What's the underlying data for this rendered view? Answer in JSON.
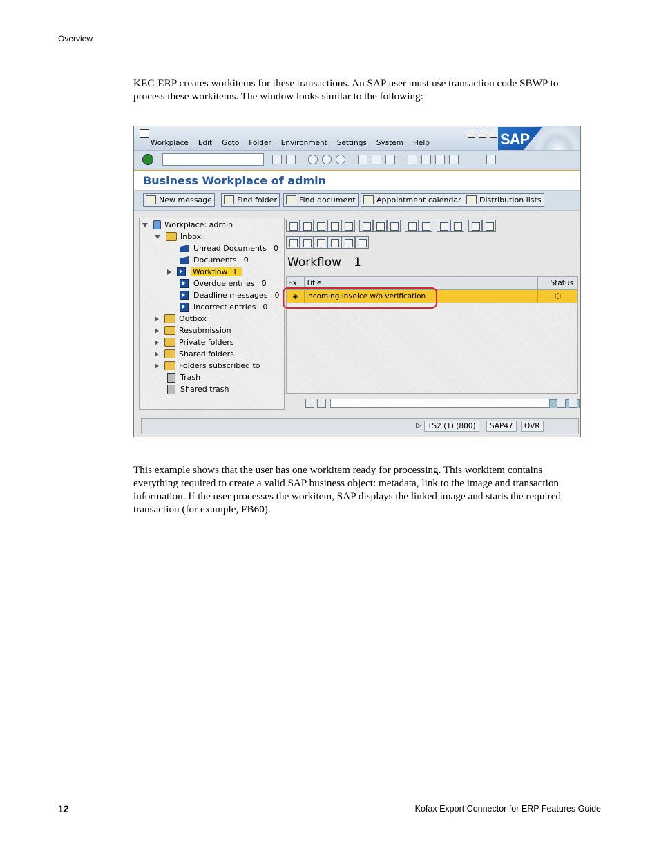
{
  "header": {
    "section": "Overview"
  },
  "intro_text": "KEC-ERP creates workitems for these transactions. An SAP user must use transaction code SBWP to process these workitems. The window looks similar to the following:",
  "closing_text": "This example shows that the user has one workitem ready for processing. This workitem contains everything required to create a valid SAP business object: metadata, link to the image and transaction information. If the user processes the workitem, SAP displays the linked image and starts the required transaction (for example, FB60).",
  "footer": {
    "page_number": "12",
    "doc_title": "Kofax Export Connector for ERP Features Guide"
  },
  "sap": {
    "logo": "SAP",
    "menu": [
      "Workplace",
      "Edit",
      "Goto",
      "Folder",
      "Environment",
      "Settings",
      "System",
      "Help"
    ],
    "screen_title": "Business Workplace of admin",
    "app_buttons": [
      "New message",
      "Find folder",
      "Find document",
      "Appointment calendar",
      "Distribution lists"
    ],
    "tree": {
      "root": "Workplace: admin",
      "inbox": "Inbox",
      "inbox_items": [
        {
          "label": "Unread Documents",
          "count": "0"
        },
        {
          "label": "Documents",
          "count": "0"
        },
        {
          "label": "Workflow",
          "count": "1"
        },
        {
          "label": "Overdue entries",
          "count": "0"
        },
        {
          "label": "Deadline messages",
          "count": "0"
        },
        {
          "label": "Incorrect entries",
          "count": "0"
        }
      ],
      "folders": [
        "Outbox",
        "Resubmission",
        "Private folders",
        "Shared folders",
        "Folders subscribed to"
      ],
      "trash": [
        "Trash",
        "Shared trash"
      ]
    },
    "list_title": "Workflow",
    "list_count": "1",
    "columns": {
      "ex": "Ex..",
      "title": "Title",
      "status": "Status"
    },
    "workitem": "Incoming invoice w/o verification",
    "statusbar": {
      "system": "TS2 (1) (800)",
      "server": "SAP47",
      "mode": "OVR"
    },
    "colors": {
      "highlight": "#f5c82e",
      "title": "#2a5a9a",
      "circle": "#d8262b"
    }
  }
}
